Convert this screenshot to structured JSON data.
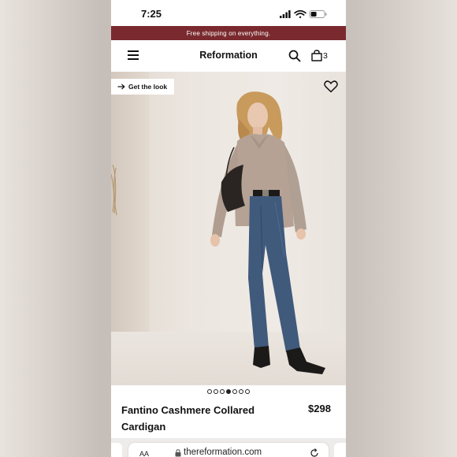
{
  "status_bar": {
    "time": "7:25",
    "icons": [
      "cellular-signal-icon",
      "wifi-icon",
      "battery-icon"
    ]
  },
  "promo_banner": {
    "text": "Free shipping on everything.",
    "background": "#7a2a2e"
  },
  "header": {
    "brand": "Reformation",
    "menu_icon": "hamburger-menu-icon",
    "search_icon": "search-icon",
    "cart_icon": "shopping-bag-icon",
    "cart_count": "3"
  },
  "product_image": {
    "get_the_look_label": "Get the look",
    "get_the_look_icon": "arrow-right-icon",
    "wishlist_icon": "heart-icon",
    "carousel": {
      "total": 7,
      "active_index": 3
    }
  },
  "product": {
    "name": "Fantino Cashmere Collared Cardigan",
    "price": "$298"
  },
  "browser": {
    "text_size_label": "AA",
    "url": "thereformation.com",
    "lock_icon": "lock-icon",
    "reload_icon": "reload-icon"
  },
  "colors": {
    "accent": "#7a2a2e",
    "text": "#111111"
  }
}
